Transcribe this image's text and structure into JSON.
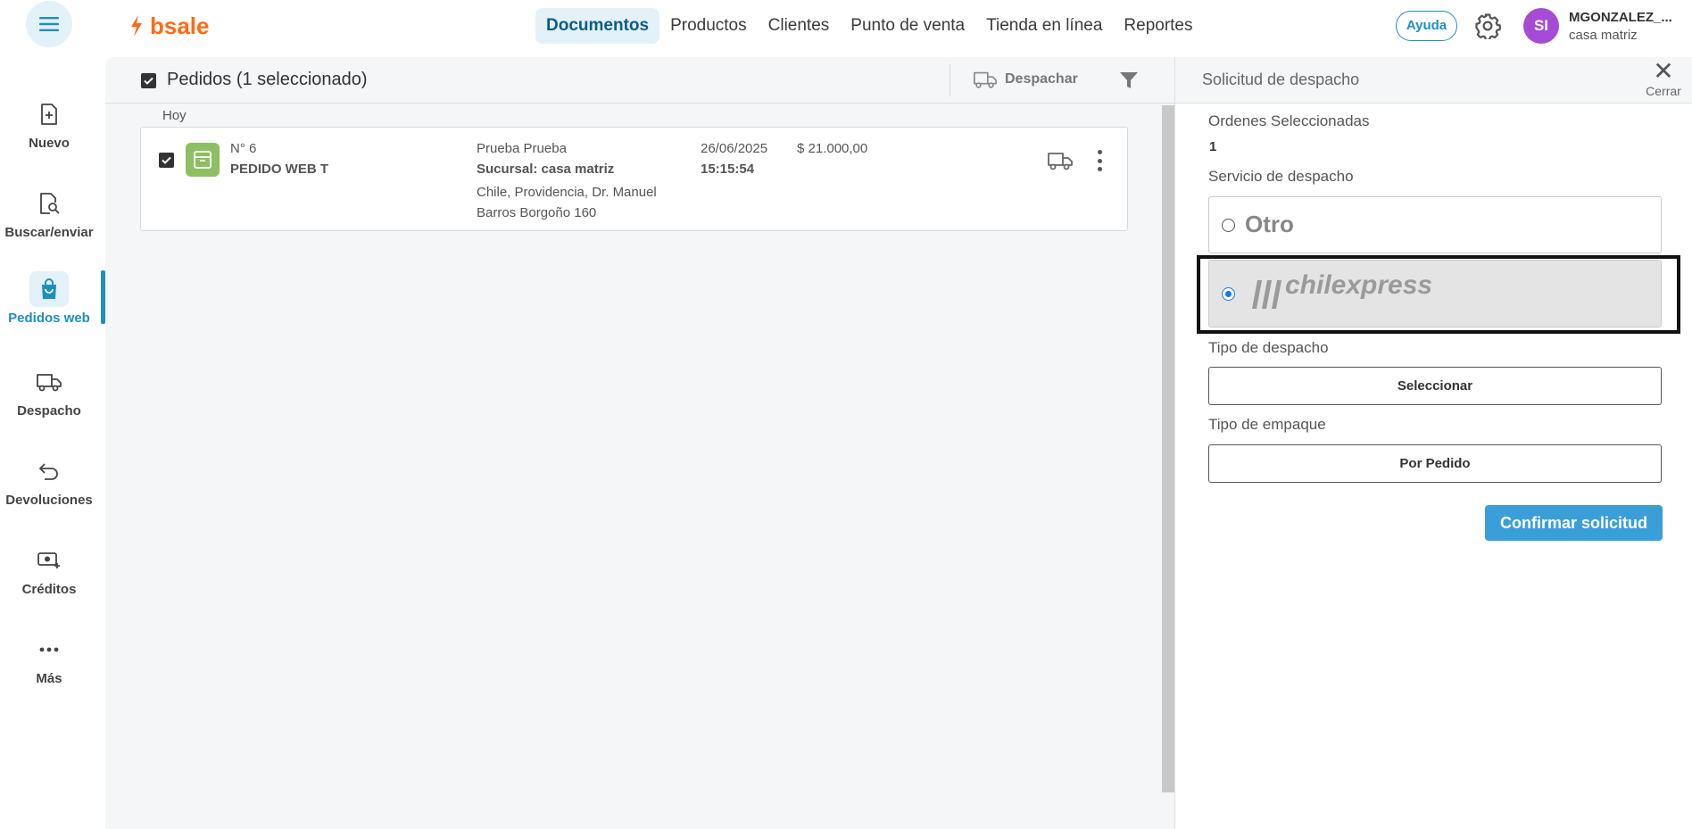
{
  "header": {
    "logo": "bsale",
    "nav": [
      "Documentos",
      "Productos",
      "Clientes",
      "Punto de venta",
      "Tienda en línea",
      "Reportes"
    ],
    "active_nav": "Documentos",
    "help_label": "Ayuda",
    "avatar_initials": "SI",
    "user_name": "MGONZALEZ_...",
    "user_branch": "casa matriz"
  },
  "sidebar": {
    "items": [
      {
        "label": "Nuevo",
        "icon": "new-document-icon"
      },
      {
        "label": "Buscar/enviar",
        "icon": "search-document-icon"
      },
      {
        "label": "Pedidos web",
        "icon": "shopping-bag-icon"
      },
      {
        "label": "Despacho",
        "icon": "truck-icon"
      },
      {
        "label": "Devoluciones",
        "icon": "return-icon"
      },
      {
        "label": "Créditos",
        "icon": "credits-icon"
      },
      {
        "label": "Más",
        "icon": "more-icon"
      }
    ],
    "active": "Pedidos web"
  },
  "list": {
    "title": "Pedidos (1 seleccionado)",
    "dispatch_label": "Despachar",
    "group_label": "Hoy",
    "orders": [
      {
        "number": "N° 6",
        "type": "PEDIDO WEB T",
        "client": "Prueba Prueba",
        "branch": "Sucursal: casa matriz",
        "address": "Chile, Providencia, Dr. Manuel Barros Borgoño 160",
        "date": "26/06/2025",
        "time": "15:15:54",
        "amount": "$ 21.000,00"
      }
    ]
  },
  "panel": {
    "title": "Solicitud de despacho",
    "close_label": "Cerrar",
    "orders_label": "Ordenes Seleccionadas",
    "orders_count": "1",
    "service_label": "Servicio de despacho",
    "options": [
      "Otro",
      "chilexpress"
    ],
    "selected_option": "chilexpress",
    "dispatch_type_label": "Tipo de despacho",
    "dispatch_type_value": "Seleccionar",
    "package_type_label": "Tipo de empaque",
    "package_type_value": "Por Pedido",
    "confirm_label": "Confirmar solicitud"
  },
  "colors": {
    "brand": "#ff6a13",
    "accent": "#1e8fbf",
    "confirm": "#3a9fd8",
    "order_icon": "#8cc063",
    "avatar": "#a64bd6"
  }
}
